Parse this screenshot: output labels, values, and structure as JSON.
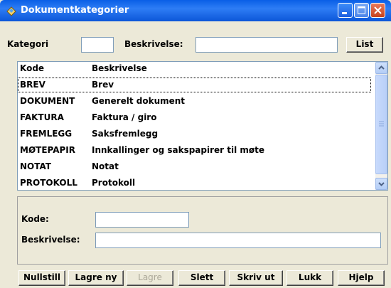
{
  "window": {
    "title": "Dokumentkategorier"
  },
  "filter": {
    "kategori_label": "Kategori",
    "kategori_value": "",
    "beskrivelse_label": "Beskrivelse:",
    "beskrivelse_value": "",
    "list_button": "List"
  },
  "list": {
    "headers": {
      "kode": "Kode",
      "beskrivelse": "Beskrivelse"
    },
    "rows": [
      {
        "kode": "BREV",
        "beskrivelse": "Brev",
        "selected": true
      },
      {
        "kode": "DOKUMENT",
        "beskrivelse": "Generelt dokument"
      },
      {
        "kode": "FAKTURA",
        "beskrivelse": "Faktura / giro"
      },
      {
        "kode": "FREMLEGG",
        "beskrivelse": "Saksfremlegg"
      },
      {
        "kode": "MØTEPAPIR",
        "beskrivelse": "Innkallinger og sakspapirer til møte"
      },
      {
        "kode": "NOTAT",
        "beskrivelse": "Notat"
      },
      {
        "kode": "PROTOKOLL",
        "beskrivelse": "Protokoll"
      }
    ]
  },
  "detail": {
    "kode_label": "Kode:",
    "kode_value": "",
    "beskrivelse_label": "Beskrivelse:",
    "beskrivelse_value": ""
  },
  "buttons": {
    "nullstill": "Nullstill",
    "lagre_ny": "Lagre ny",
    "lagre": "Lagre",
    "slett": "Slett",
    "skriv_ut": "Skriv ut",
    "lukk": "Lukk",
    "hjelp": "Hjelp"
  },
  "colors": {
    "titlebar": "#0a5fe6",
    "window_bg": "#ece9d8",
    "disabled_text": "#aca899"
  }
}
